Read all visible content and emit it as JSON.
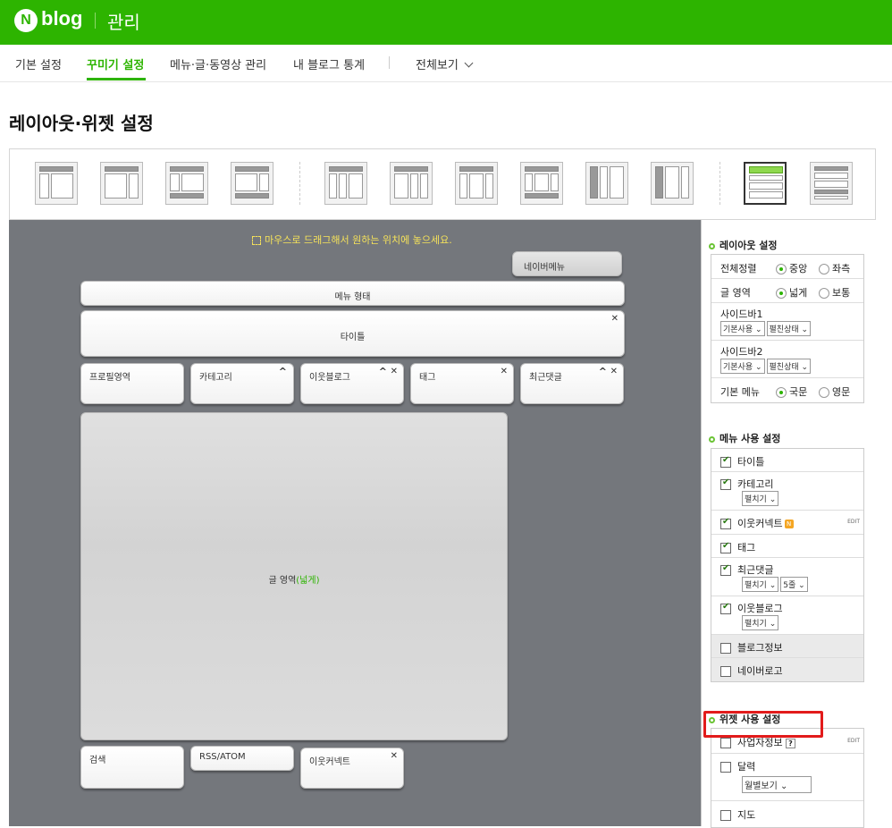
{
  "header": {
    "logo_letter": "N",
    "brand": "blog",
    "title": "관리"
  },
  "nav": {
    "items": [
      "기본 설정",
      "꾸미기 설정",
      "메뉴·글·동영상 관리",
      "내 블로그 통계"
    ],
    "more": "전체보기",
    "active_index": 1
  },
  "page_title": "레이아웃·위젯 설정",
  "canvas": {
    "hint": "마우스로 드래그해서 원하는 위치에 놓으세요.",
    "blocks": {
      "naver_menu": "네이버메뉴",
      "menu_type": "메뉴 형태",
      "title": "타이틀",
      "profile": "프로필영역",
      "category": "카테고리",
      "neighbor_blog": "이웃블로그",
      "tag": "태그",
      "recent_comments": "최근댓글",
      "post_area": "글 영역",
      "post_area_mode": "(넓게)",
      "search": "검색",
      "rss": "RSS/ATOM",
      "neighbor_connect": "이웃커넥트"
    }
  },
  "layout_settings": {
    "heading": "레이아웃 설정",
    "align_label": "전체정렬",
    "align_opts": [
      "중앙",
      "좌측"
    ],
    "post_label": "글 영역",
    "post_opts": [
      "넓게",
      "보통"
    ],
    "sidebar1_label": "사이드바1",
    "sidebar1_sel": [
      "기본사용",
      "펼친상태"
    ],
    "sidebar2_label": "사이드바2",
    "sidebar2_sel": [
      "기본사용",
      "펼친상태"
    ],
    "menu_label": "기본 메뉴",
    "menu_opts": [
      "국문",
      "영문"
    ]
  },
  "menu_settings": {
    "heading": "메뉴 사용 설정",
    "title": "타이틀",
    "category": "카테고리",
    "category_sel": "펼치기",
    "neighbor_connect": "이웃커넥트",
    "neighbor_badge": "N",
    "edit": "EDIT",
    "tag": "태그",
    "recent_comments": "최근댓글",
    "recent_sel1": "펼치기",
    "recent_sel2": "5줄",
    "neighbor_blog": "이웃블로그",
    "neighbor_blog_sel": "펼치기",
    "blog_info": "블로그정보",
    "naver_logo": "네이버로고"
  },
  "widget_settings": {
    "heading": "위젯 사용 설정",
    "business": "사업자정보",
    "help": "?",
    "edit": "EDIT",
    "calendar": "달력",
    "calendar_sel": "월별보기",
    "map": "지도"
  }
}
